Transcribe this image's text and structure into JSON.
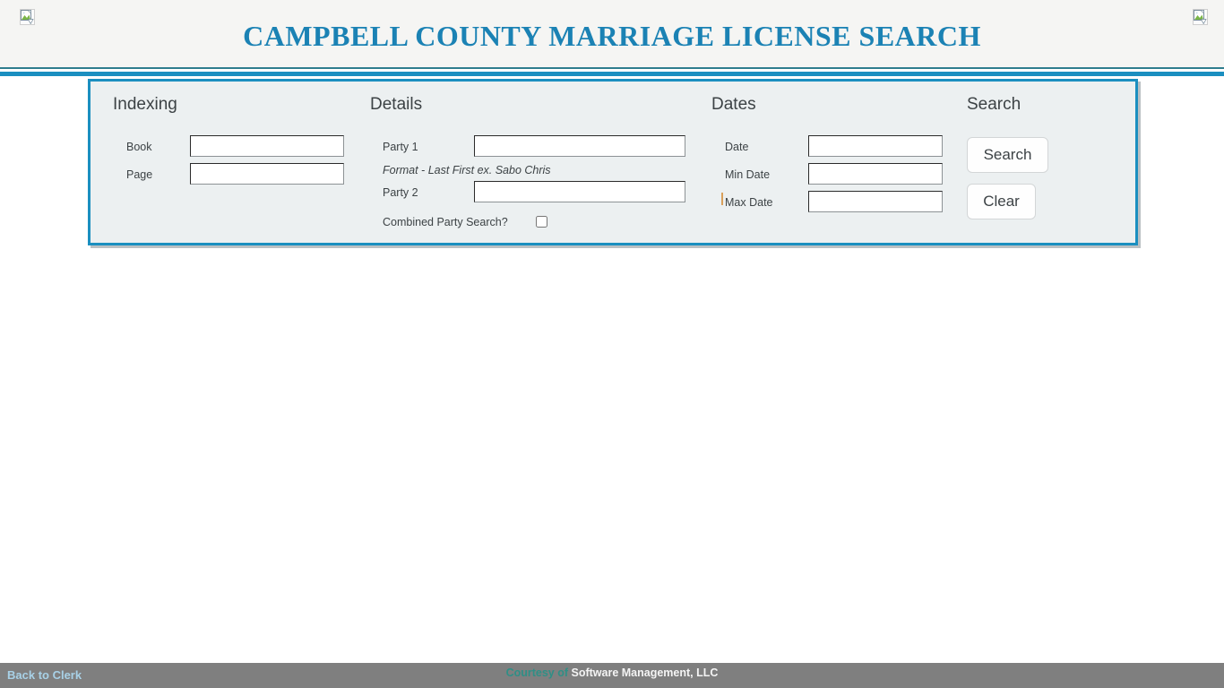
{
  "header": {
    "title": "CAMPBELL COUNTY MARRIAGE LICENSE SEARCH",
    "title_color": "#1b82b4",
    "left_image_alt": "broken-image-icon",
    "right_image_alt": "broken-image-icon"
  },
  "panel": {
    "accent_color": "#1b8fc0",
    "background_color": "#ecf0f1",
    "columns": {
      "indexing": {
        "heading": "Indexing",
        "fields": [
          {
            "label": "Book",
            "value": "",
            "placeholder": ""
          },
          {
            "label": "Page",
            "value": "",
            "placeholder": ""
          }
        ]
      },
      "details": {
        "heading": "Details",
        "fields": [
          {
            "label": "Party 1",
            "value": "",
            "placeholder": ""
          },
          {
            "label": "Party 2",
            "value": "",
            "placeholder": ""
          }
        ],
        "hint": "Format - Last First ex. Sabo Chris",
        "checkbox": {
          "label": "Combined Party Search?",
          "checked": false
        }
      },
      "dates": {
        "heading": "Dates",
        "fields": [
          {
            "label": "Date",
            "value": "",
            "placeholder": ""
          },
          {
            "label": "Min Date",
            "value": "",
            "placeholder": ""
          },
          {
            "label": "Max Date",
            "value": "",
            "placeholder": ""
          }
        ]
      },
      "search": {
        "heading": "Search",
        "buttons": [
          {
            "label": "Search"
          },
          {
            "label": "Clear"
          }
        ]
      }
    }
  },
  "footer": {
    "background_color": "#7f7f7f",
    "back_link": "Back to Clerk",
    "credit_prefix": "Courtesy of",
    "credit_company": "Software Management, LLC"
  }
}
